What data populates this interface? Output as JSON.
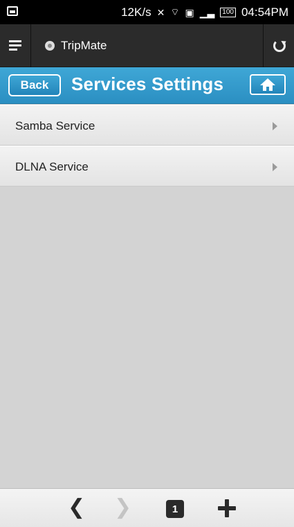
{
  "status_bar": {
    "net_speed": "12K/s",
    "battery": "100",
    "time": "04:54PM"
  },
  "browser": {
    "site_title": "TripMate"
  },
  "header": {
    "back_label": "Back",
    "title": "Services Settings"
  },
  "list": {
    "items": [
      {
        "label": "Samba Service"
      },
      {
        "label": "DLNA Service"
      }
    ]
  },
  "bottom_bar": {
    "back_glyph": "❮",
    "forward_glyph": "❯",
    "tab_count": "1"
  },
  "colors": {
    "header_blue": "#2b8fc2",
    "status_black": "#000000",
    "browser_bar": "#2b2b2b",
    "content_bg": "#d3d3d3"
  }
}
